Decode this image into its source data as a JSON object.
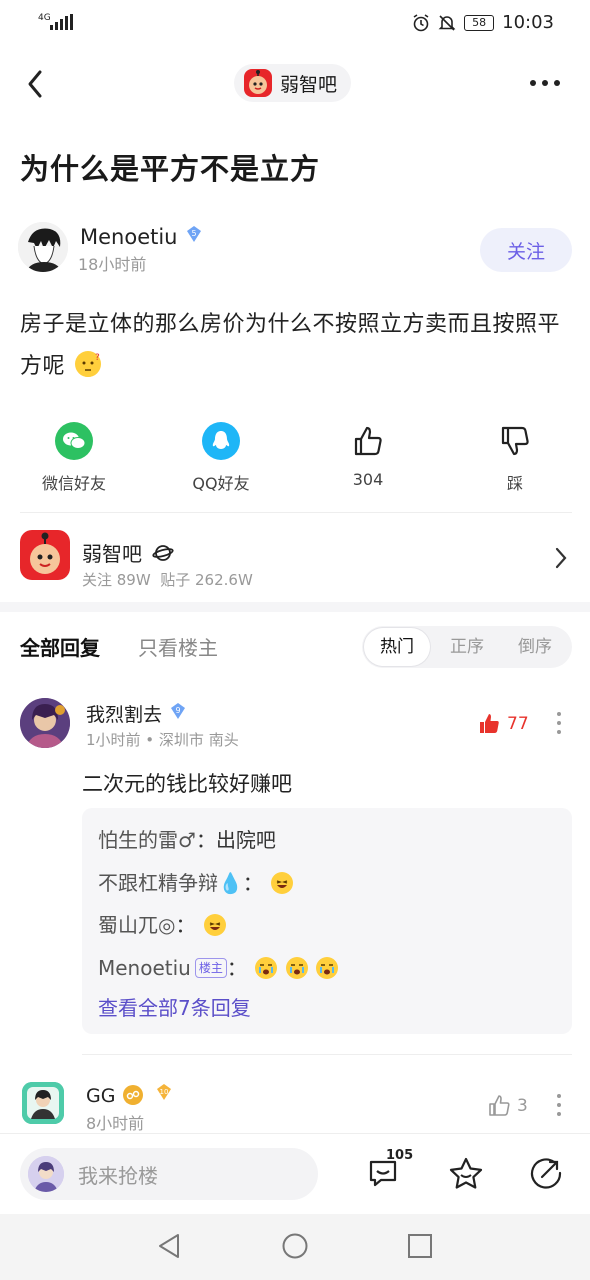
{
  "status_bar": {
    "network": "4G",
    "time": "10:03",
    "battery": "58"
  },
  "header": {
    "forum_name": "弱智吧"
  },
  "post": {
    "title": "为什么是平方不是立方",
    "author": {
      "name": "Menoetiu",
      "level": "5",
      "time": "18小时前"
    },
    "follow_label": "关注",
    "body": "房子是立体的那么房价为什么不按照立方卖而且按照平方呢"
  },
  "actions": [
    {
      "label": "微信好友",
      "icon": "wechat-icon"
    },
    {
      "label": "QQ好友",
      "icon": "qq-icon"
    },
    {
      "label": "304",
      "icon": "thumbs-up-icon"
    },
    {
      "label": "踩",
      "icon": "thumbs-down-icon"
    }
  ],
  "forum_card": {
    "name": "弱智吧",
    "followers": "关注 89W",
    "posts": "贴子 262.6W"
  },
  "tabs": {
    "all": "全部回复",
    "op_only": "只看楼主",
    "sort": [
      "热门",
      "正序",
      "倒序"
    ]
  },
  "comment1": {
    "name": "我烈割去",
    "level": "9",
    "meta": "1小时前 • 深圳市 南头",
    "likes": "77",
    "text": "二次元的钱比较好赚吧",
    "replies": [
      {
        "who": "怕生的雷♂",
        "sep": "：",
        "text": "出院吧"
      },
      {
        "who": "不跟杠精争辩💧",
        "sep": "："
      },
      {
        "who": "蜀山兀◎",
        "sep": "："
      },
      {
        "who": "Menoetiu",
        "tag": "楼主",
        "sep": "："
      }
    ],
    "view_all": "查看全部7条回复"
  },
  "comment2": {
    "name": "GG",
    "level": "10",
    "time": "8小时前",
    "likes": "3"
  },
  "input_bar": {
    "placeholder": "我来抢楼",
    "comment_count": "105"
  }
}
